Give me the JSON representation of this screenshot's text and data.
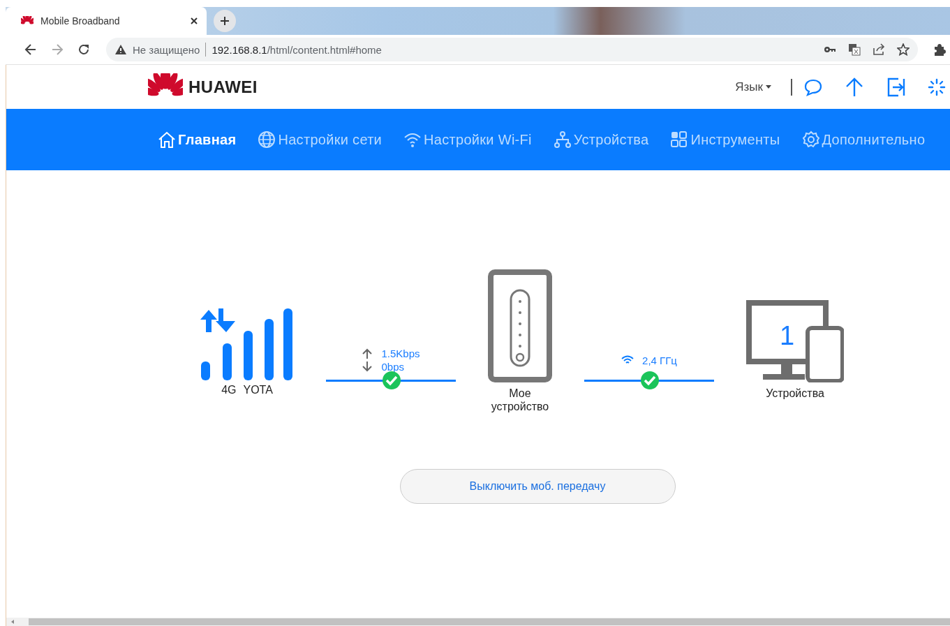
{
  "browser": {
    "tab": {
      "title": "Mobile Broadband"
    },
    "security": "Не защищено",
    "url_host": "192.168.8.1",
    "url_path": "/html/content.html#home"
  },
  "header": {
    "brand": "HUAWEI",
    "language": "Язык"
  },
  "nav": [
    {
      "label": "Главная",
      "selected": true
    },
    {
      "label": "Настройки сети",
      "selected": false
    },
    {
      "label": "Настройки Wi-Fi",
      "selected": false
    },
    {
      "label": "Устройства",
      "selected": false
    },
    {
      "label": "Инструменты",
      "selected": false
    },
    {
      "label": "Дополнительно",
      "selected": false
    }
  ],
  "status": {
    "network_type": "4G",
    "operator": "YOTA",
    "upload": "1.5Kbps",
    "download": "0bps",
    "internet_connected": true,
    "router_label": "Мое устройство",
    "band": "2,4 ГГц",
    "wifi_connected": true,
    "device_count": "1",
    "devices_label": "Устройства"
  },
  "action_button": "Выключить моб. передачу"
}
